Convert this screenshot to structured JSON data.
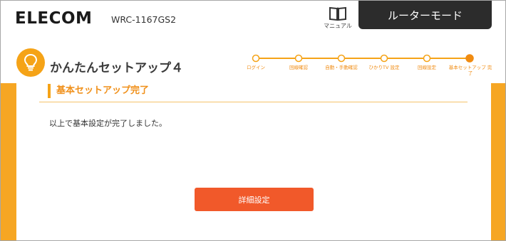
{
  "header": {
    "brand": "ELECOM",
    "model": "WRC-1167GS2",
    "manual_label": "マニュアル",
    "mode_tab": "ルーターモード"
  },
  "title": {
    "text": "かんたんセットアップ４",
    "icon": "lightbulb-icon"
  },
  "stepper": {
    "steps": [
      {
        "label": "ログイン"
      },
      {
        "label": "回線確認"
      },
      {
        "label": "自動・手動確認"
      },
      {
        "label": "ひかりTV 設定"
      },
      {
        "label": "回線設定"
      },
      {
        "label": "基本セットアップ 完了"
      }
    ],
    "current_step": 6
  },
  "content": {
    "section_title": "基本セットアップ完了",
    "message": "以上で基本設定が完了しました。",
    "detail_button": "詳細設定"
  },
  "colors": {
    "accent": "#f5a317",
    "button": "#f1592a",
    "tab": "#2c2c2c"
  }
}
